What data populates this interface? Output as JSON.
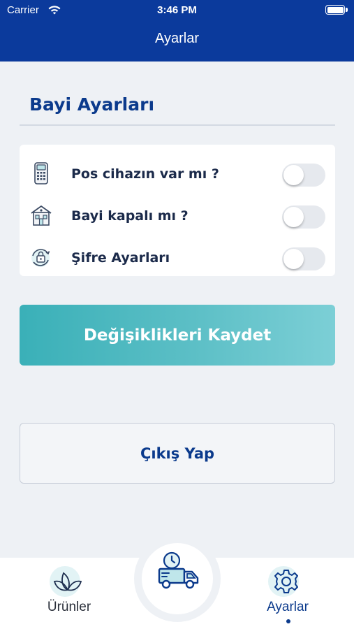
{
  "status_bar": {
    "carrier": "Carrier",
    "time": "3:46 PM",
    "wifi_icon": "wifi-icon",
    "battery_icon": "battery-icon"
  },
  "nav": {
    "title": "Ayarlar",
    "background": "#0b3a9c"
  },
  "section": {
    "title": "Bayi Ayarları"
  },
  "settings": [
    {
      "icon": "pos-terminal-icon",
      "label": "Pos cihazın var mı ?",
      "enabled": false
    },
    {
      "icon": "store-icon",
      "label": "Bayi kapalı mı ?",
      "enabled": false
    },
    {
      "icon": "password-lock-icon",
      "label": "Şifre Ayarları",
      "enabled": false
    }
  ],
  "actions": {
    "save_label": "Değişiklikleri Kaydet",
    "logout_label": "Çıkış Yap"
  },
  "tab_bar": {
    "tabs": [
      {
        "label": "Ürünler",
        "icon": "leaf-icon",
        "active": false
      },
      {
        "label": "Ayarlar",
        "icon": "gear-icon",
        "active": true
      }
    ],
    "center_icon": "delivery-truck-clock-icon"
  },
  "colors": {
    "accent_dark": "#0b3a8c",
    "teal": "#3ab0b8",
    "toggle_off": "#e6e9ee"
  }
}
